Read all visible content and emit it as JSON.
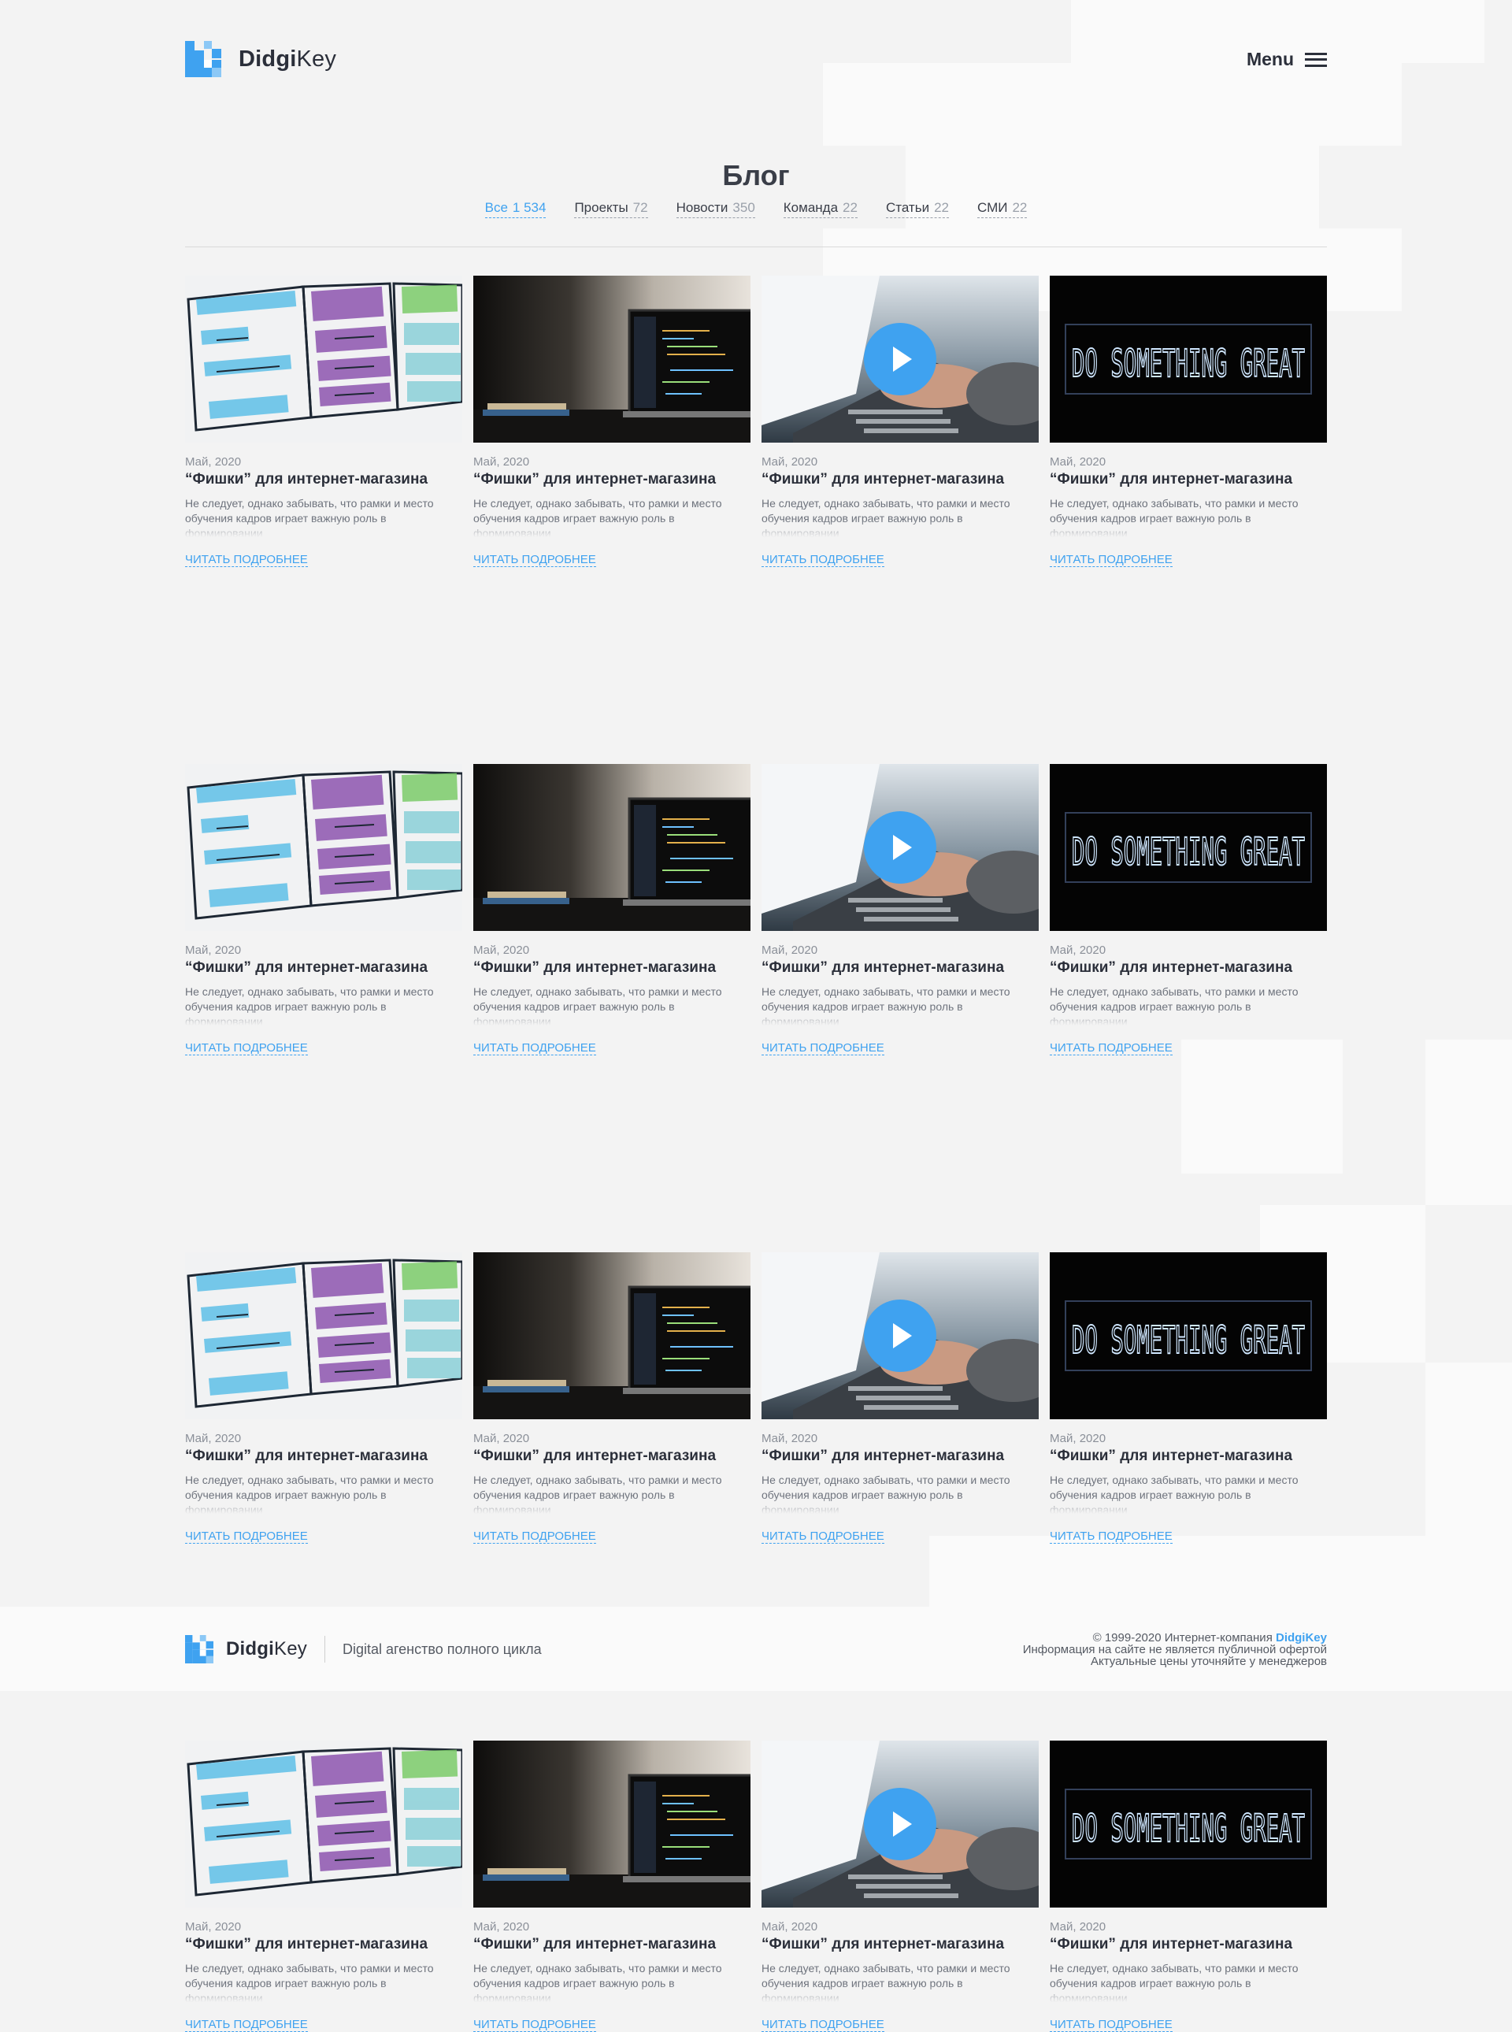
{
  "header": {
    "logo_bold": "Didgi",
    "logo_light": "Key",
    "menu_label": "Menu"
  },
  "page_title": "Блог",
  "tabs": [
    {
      "label": "Все",
      "count": "1 534",
      "active": true
    },
    {
      "label": "Проекты",
      "count": "72",
      "active": false
    },
    {
      "label": "Новости",
      "count": "350",
      "active": false
    },
    {
      "label": "Команда",
      "count": "22",
      "active": false
    },
    {
      "label": "Статьи",
      "count": "22",
      "active": false
    },
    {
      "label": "СМИ",
      "count": "22",
      "active": false
    }
  ],
  "card": {
    "date": "Май, 2020",
    "title": "“Фишки” для интернет-магазина",
    "description": "Не следует, однако забывать, что рамки и место обучения кадров играет важную роль в формировании",
    "more_label": "ЧИТАТЬ ПОДРОБНЕЕ"
  },
  "thumbnails": [
    {
      "image": "sketch-wireframes",
      "video": false
    },
    {
      "image": "laptop-code-desk",
      "video": false
    },
    {
      "image": "hands-typing-laptop",
      "video": true
    },
    {
      "image": "neon-sign",
      "video": false,
      "sign_text": "DO SOMETHING GREAT"
    }
  ],
  "rows": 4,
  "footer": {
    "tagline": "Digital агенство полного цикла",
    "copyright_prefix": "© 1999-2020 Интернет-компания ",
    "copyright_brand": "DidgiKey",
    "disclaimer_1": "Информация на сайте не является публичной офертой",
    "disclaimer_2": "Актуальные цены уточняйте у менеджеров"
  },
  "colors": {
    "accent": "#3fa2f0",
    "background": "#f3f3f3",
    "text": "#2b2f3a"
  }
}
